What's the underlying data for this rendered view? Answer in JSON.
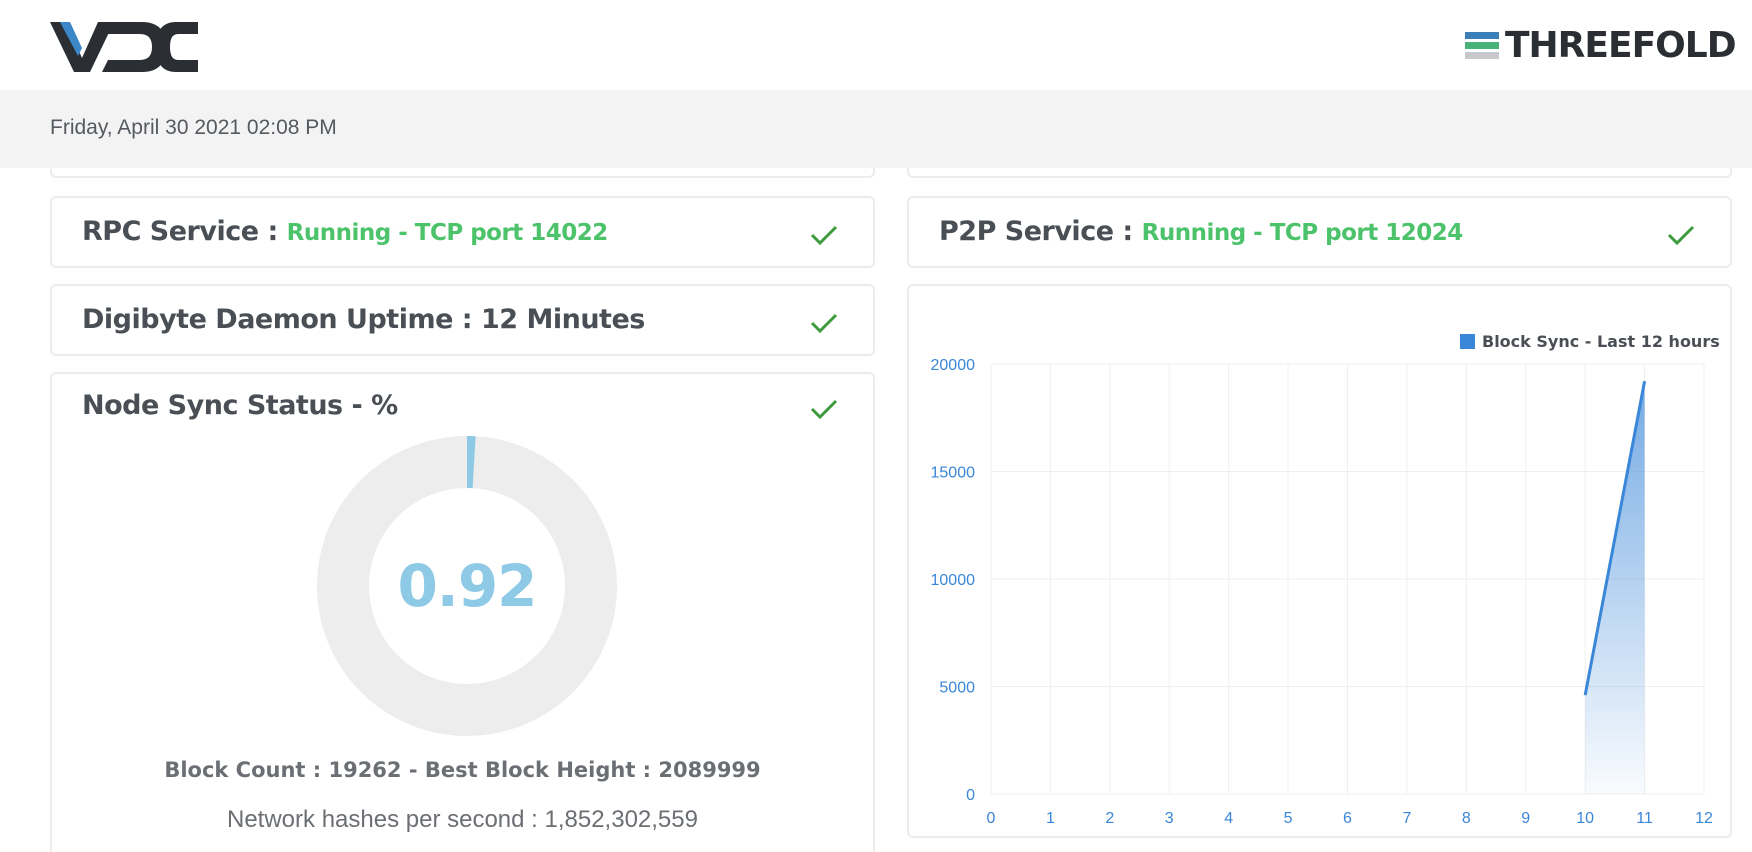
{
  "header": {
    "brand_left": "VDC",
    "brand_right": "THREEFOLD"
  },
  "datebar": {
    "datetime": "Friday, April 30 2021 02:08 PM"
  },
  "cards": {
    "rpc": {
      "label": "RPC Service : ",
      "status": "Running - TCP port 14022"
    },
    "p2p": {
      "label": "P2P Service : ",
      "status": "Running - TCP port 12024"
    },
    "uptime": {
      "label": "Digibyte Daemon Uptime : 12 Minutes"
    },
    "sync": {
      "label": "Node Sync Status - %",
      "percent": 0.92,
      "percent_text": "0.92",
      "block_line": "Block Count : 19262 - Best Block Height : 2089999",
      "hash_line": "Network hashes per second : 1,852,302,559"
    }
  },
  "colors": {
    "status_green": "#4cc36a",
    "check_green": "#3d9a3d",
    "chart_blue": "#3a86d8",
    "donut_track": "#ededed",
    "donut_fill": "#8ec9e6"
  },
  "chart_data": {
    "type": "area",
    "series": [
      {
        "name": "Block Sync - Last 12 hours",
        "x": [
          10,
          11
        ],
        "y": [
          4600,
          19200
        ]
      }
    ],
    "xlim": [
      0,
      12
    ],
    "ylim": [
      0,
      20000
    ],
    "x_ticks": [
      "0",
      "1",
      "2",
      "3",
      "4",
      "5",
      "6",
      "7",
      "8",
      "9",
      "10",
      "11",
      "12"
    ],
    "y_ticks": [
      "0",
      "5000",
      "10000",
      "15000",
      "20000"
    ],
    "grid": true,
    "legend_placement": "top-right"
  }
}
